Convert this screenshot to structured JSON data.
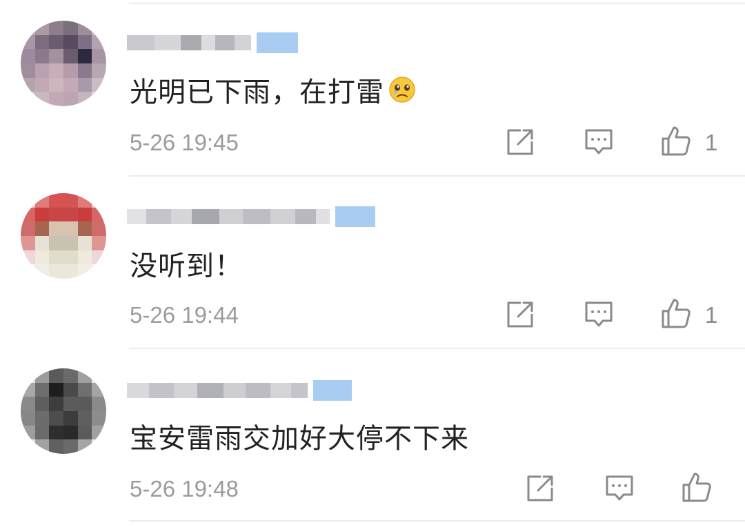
{
  "comments": [
    {
      "text": "光明已下雨，在打雷",
      "emoji_icon": "crying-face-emoji",
      "timestamp": "5-26 19:45",
      "likes": "1"
    },
    {
      "text": "没听到！",
      "timestamp": "5-26 19:44",
      "likes": "1"
    },
    {
      "text": "宝安雷雨交加好大停不下来",
      "timestamp": "5-26 19:48",
      "likes": ""
    }
  ],
  "icons": {
    "share": "share-icon",
    "reply": "reply-icon",
    "like": "thumbs-up-icon"
  },
  "colors": {
    "text": "#222222",
    "meta": "#9b9b9b",
    "icon": "#8a8a8a",
    "badge": "#a9ccf3",
    "divider": "#ececec"
  }
}
